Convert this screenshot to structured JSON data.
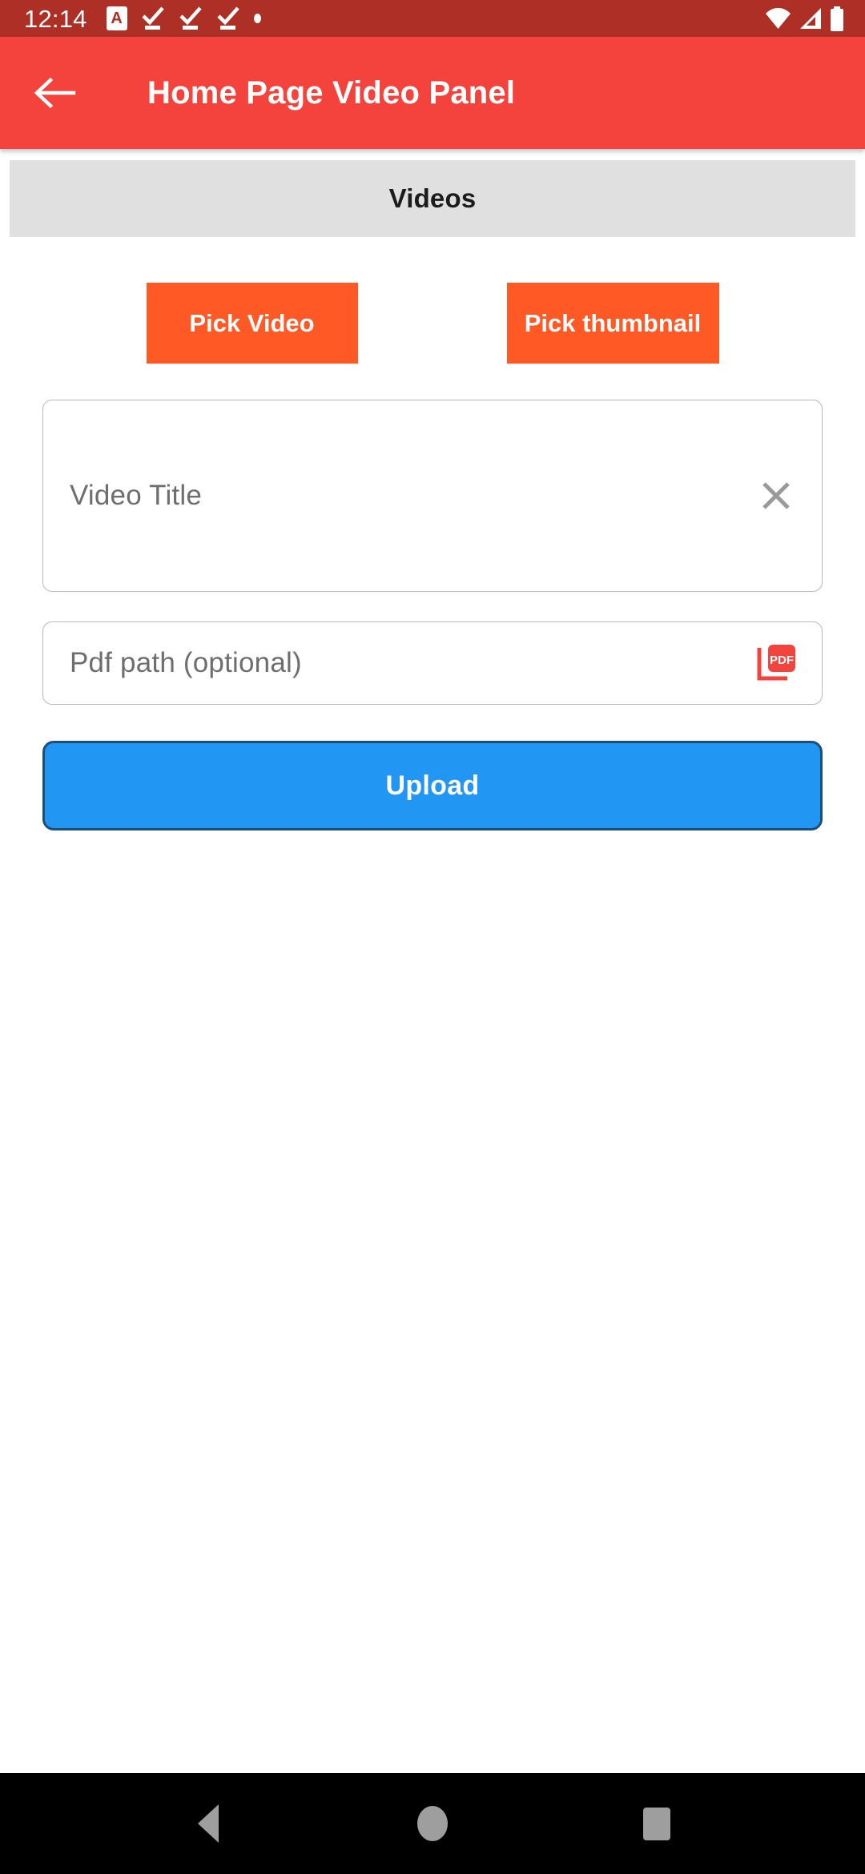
{
  "status_bar": {
    "time": "12:14",
    "background_color": "#AE2F25",
    "icons": [
      {
        "name": "app-notification-badge",
        "glyph": "A"
      },
      {
        "name": "task-complete-icon-1",
        "glyph": "check-underline"
      },
      {
        "name": "task-complete-icon-2",
        "glyph": "check-underline"
      },
      {
        "name": "task-complete-icon-3",
        "glyph": "check-underline"
      },
      {
        "name": "more-notifications-dot",
        "glyph": "dot"
      }
    ],
    "right_icons": [
      {
        "name": "wifi-icon"
      },
      {
        "name": "cell-signal-icon"
      },
      {
        "name": "battery-icon"
      }
    ]
  },
  "app_bar": {
    "title": "Home Page Video Panel",
    "back_label": "Back",
    "background_color": "#F4433C",
    "text_color": "#FFFFFF"
  },
  "section": {
    "header": "Videos",
    "header_background": "#E0E0E0"
  },
  "pickers": {
    "video_button": "Pick Video",
    "thumbnail_button": "Pick thumbnail",
    "color": "#FF5A26"
  },
  "form": {
    "title_field": {
      "placeholder": "Video Title",
      "value": "",
      "clear_icon": "close-icon"
    },
    "pdf_field": {
      "placeholder": "Pdf path (optional)",
      "value": "",
      "icon": "pdf-file-icon",
      "icon_color": "#F44336"
    },
    "upload_button": {
      "label": "Upload",
      "color": "#2196F3",
      "border_color": "#1B4F7A"
    }
  },
  "nav_bar": {
    "background_color": "#000000",
    "buttons": [
      {
        "name": "nav-back-button",
        "label": "Back"
      },
      {
        "name": "nav-home-button",
        "label": "Home"
      },
      {
        "name": "nav-recents-button",
        "label": "Recents"
      }
    ]
  }
}
